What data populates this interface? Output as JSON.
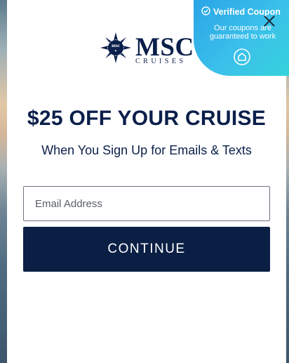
{
  "brand": {
    "name": "MSC",
    "subtitle": "CRUISES",
    "emblem_text": "msc",
    "navy": "#0b1f4a"
  },
  "offer": {
    "headline": "$25 OFF YOUR CRUISE",
    "subheadline": "When You Sign Up for Emails & Texts"
  },
  "form": {
    "email_placeholder": "Email Address",
    "email_value": "",
    "continue_label": "CONTINUE",
    "button_color": "#0b1f45"
  },
  "coupon_badge": {
    "title": "Verified Coupon",
    "message": "Our coupons are guaranteed to work",
    "check_icon": "check-circle-icon",
    "logo_icon": "home-badge-icon",
    "colors": [
      "#2aa5e6",
      "#35d3dc"
    ]
  },
  "close_icon": "close-icon"
}
